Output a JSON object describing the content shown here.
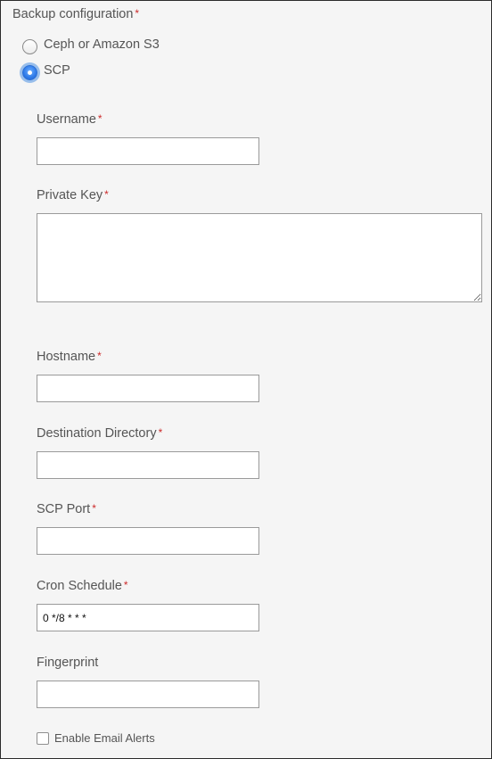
{
  "form": {
    "section_title": "Backup configuration",
    "required_mark": "*",
    "radio_options": [
      {
        "label": "Ceph or Amazon S3",
        "checked": false
      },
      {
        "label": "SCP",
        "checked": true
      }
    ],
    "fields": {
      "username": {
        "label": "Username",
        "value": ""
      },
      "private_key": {
        "label": "Private Key",
        "value": ""
      },
      "hostname": {
        "label": "Hostname",
        "value": ""
      },
      "destination_directory": {
        "label": "Destination Directory",
        "value": ""
      },
      "scp_port": {
        "label": "SCP Port",
        "value": ""
      },
      "cron_schedule": {
        "label": "Cron Schedule",
        "value": "0 */8 * * *"
      },
      "fingerprint": {
        "label": "Fingerprint",
        "value": ""
      }
    },
    "email_alerts": {
      "label": "Enable Email Alerts",
      "checked": false
    }
  },
  "colors": {
    "panel_background": "#f5f5f5",
    "required_asterisk": "#cc2a2a",
    "radio_selected": "#2e7ae8",
    "text": "#555555"
  }
}
